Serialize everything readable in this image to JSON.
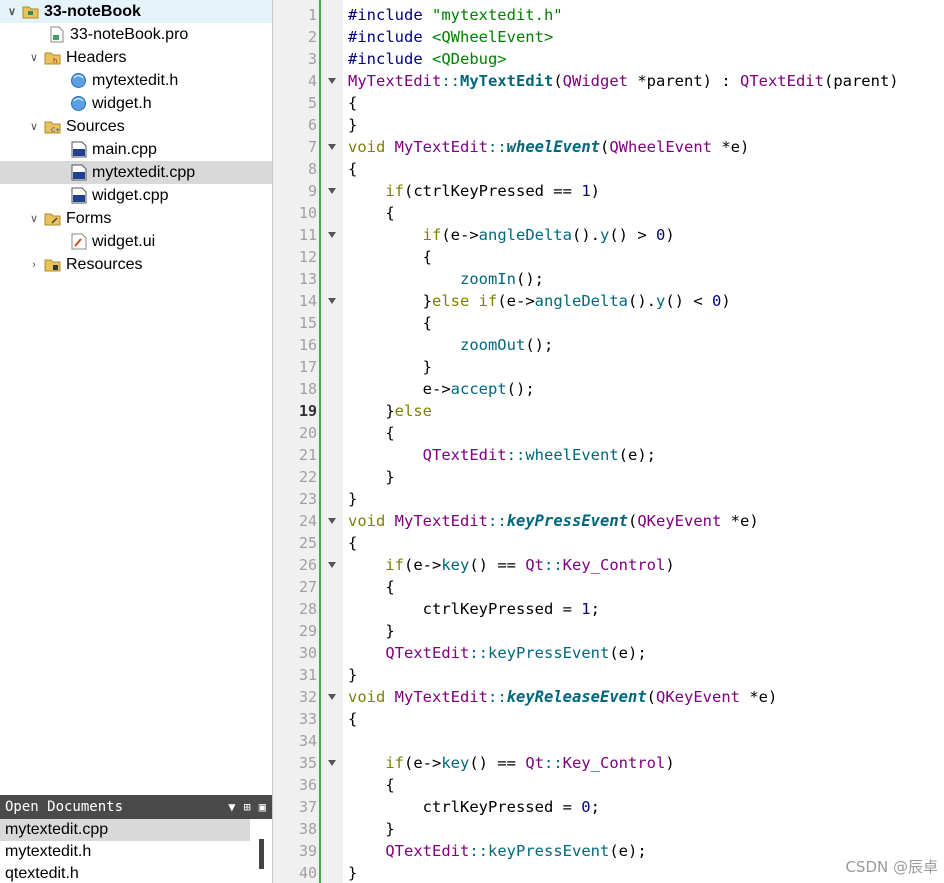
{
  "project_tree": {
    "project": "33-noteBook",
    "pro_file": "33-noteBook.pro",
    "headers_label": "Headers",
    "headers": [
      "mytextedit.h",
      "widget.h"
    ],
    "sources_label": "Sources",
    "sources": [
      "main.cpp",
      "mytextedit.cpp",
      "widget.cpp"
    ],
    "forms_label": "Forms",
    "forms": [
      "widget.ui"
    ],
    "resources_label": "Resources"
  },
  "open_documents": {
    "title": "Open Documents",
    "files": [
      "mytextedit.cpp",
      "mytextedit.h",
      "qtextedit.h"
    ]
  },
  "editor": {
    "current_line": 19,
    "line_numbers": [
      "1",
      "2",
      "3",
      "4",
      "5",
      "6",
      "7",
      "8",
      "9",
      "10",
      "11",
      "12",
      "13",
      "14",
      "15",
      "16",
      "17",
      "18",
      "19",
      "20",
      "21",
      "22",
      "23",
      "24",
      "25",
      "26",
      "27",
      "28",
      "29",
      "30",
      "31",
      "32",
      "33",
      "34",
      "35",
      "36",
      "37",
      "38",
      "39",
      "40"
    ],
    "lines": [
      "#include \"mytextedit.h\"",
      "#include <QWheelEvent>",
      "#include <QDebug>",
      "MyTextEdit::MyTextEdit(QWidget *parent) : QTextEdit(parent)",
      "{",
      "}",
      "void MyTextEdit::wheelEvent(QWheelEvent *e)",
      "{",
      "    if(ctrlKeyPressed == 1)",
      "    {",
      "        if(e->angleDelta().y() > 0)",
      "        {",
      "            zoomIn();",
      "        }else if(e->angleDelta().y() < 0)",
      "        {",
      "            zoomOut();",
      "        }",
      "        e->accept();",
      "    }else",
      "    {",
      "        QTextEdit::wheelEvent(e);",
      "    }",
      "}",
      "void MyTextEdit::keyPressEvent(QKeyEvent *e)",
      "{",
      "    if(e->key() == Qt::Key_Control)",
      "    {",
      "        ctrlKeyPressed = 1;",
      "    }",
      "    QTextEdit::keyPressEvent(e);",
      "}",
      "void MyTextEdit::keyReleaseEvent(QKeyEvent *e)",
      "{",
      "",
      "    if(e->key() == Qt::Key_Control)",
      "    {",
      "        ctrlKeyPressed = 0;",
      "    }",
      "    QTextEdit::keyPressEvent(e);",
      "}"
    ]
  },
  "watermark": "CSDN @辰卓"
}
